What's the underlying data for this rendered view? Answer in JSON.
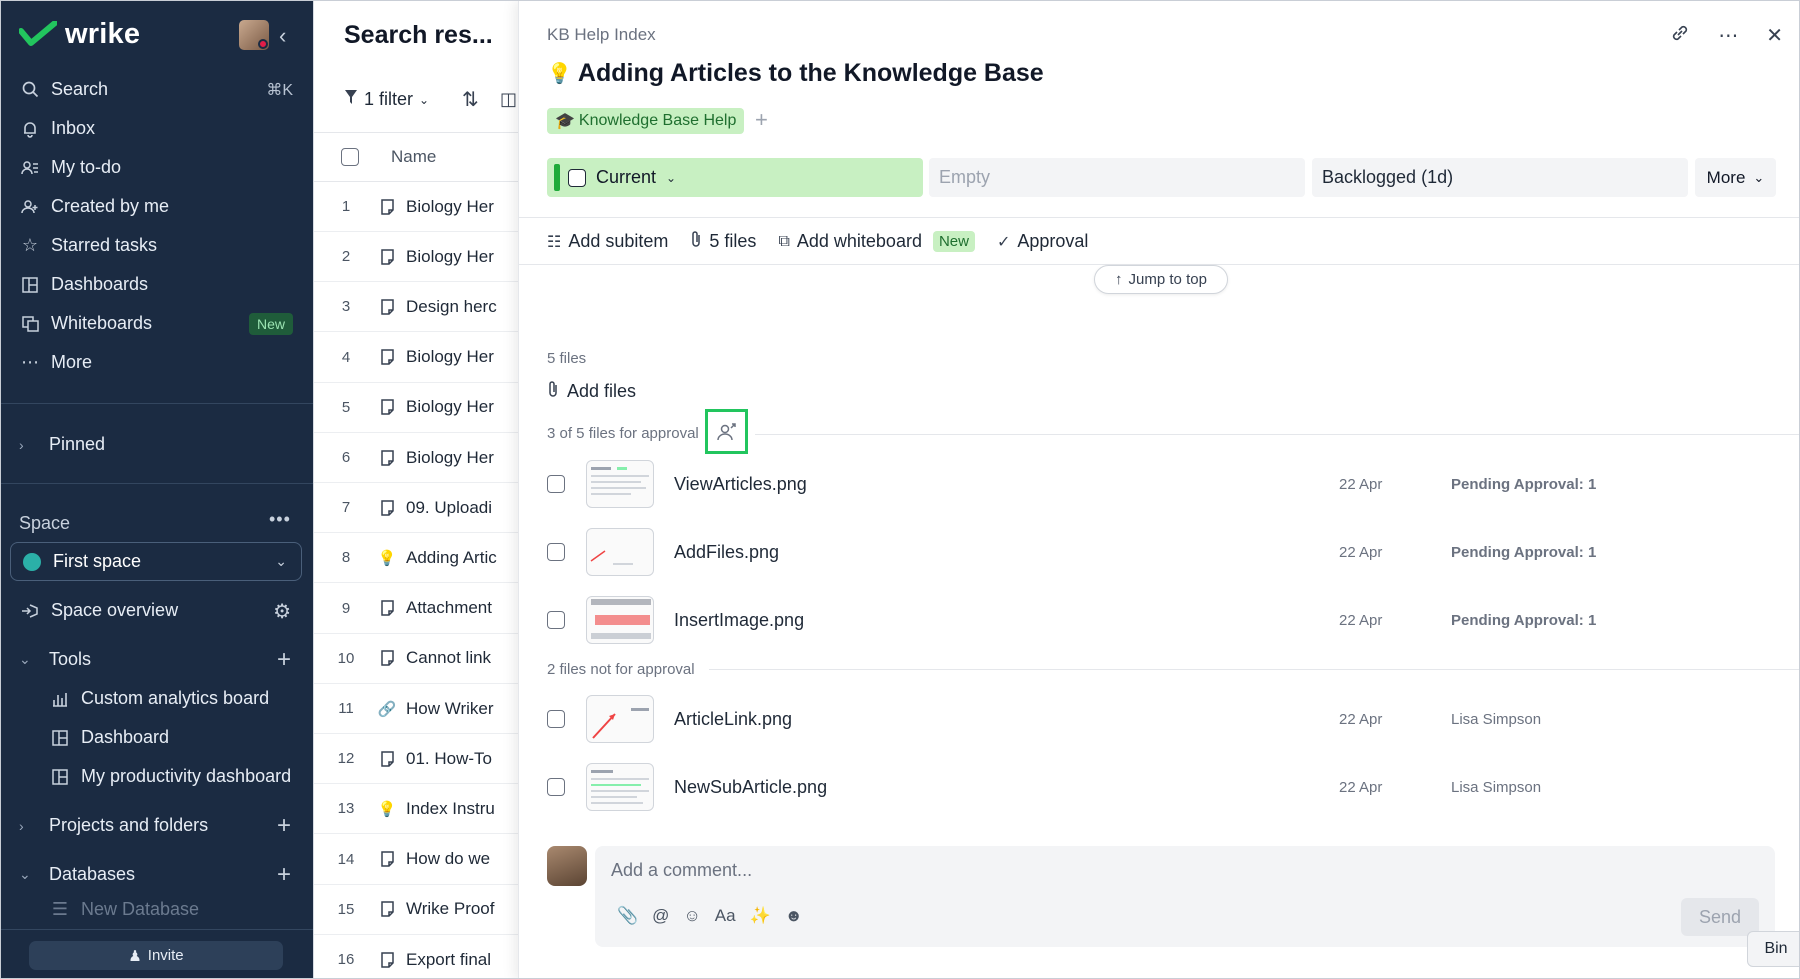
{
  "sidebar": {
    "brand": "wrike",
    "nav": [
      {
        "label": "Search",
        "icon": "search-icon",
        "shortcut": "⌘K"
      },
      {
        "label": "Inbox",
        "icon": "bell-icon"
      },
      {
        "label": "My to-do",
        "icon": "todo-icon"
      },
      {
        "label": "Created by me",
        "icon": "user-plus-icon"
      },
      {
        "label": "Starred tasks",
        "icon": "star-icon"
      },
      {
        "label": "Dashboards",
        "icon": "dashboard-icon"
      },
      {
        "label": "Whiteboards",
        "icon": "whiteboard-icon",
        "badge": "New"
      },
      {
        "label": "More",
        "icon": "more-icon"
      }
    ],
    "pinned": "Pinned",
    "space_label": "Space",
    "space_selected": "First space",
    "space_overview": "Space overview",
    "tools": "Tools",
    "tool_items": [
      "Custom analytics board",
      "Dashboard",
      "My productivity dashboard"
    ],
    "projects": "Projects and folders",
    "databases": "Databases",
    "new_database": "New Database",
    "invite": "Invite"
  },
  "middle": {
    "title": "Search res...",
    "filter": "1 filter",
    "column_name": "Name",
    "rows": [
      {
        "num": "1",
        "title": "Biology Her",
        "icon": "doc"
      },
      {
        "num": "2",
        "title": "Biology Her",
        "icon": "doc"
      },
      {
        "num": "3",
        "title": "Design herc",
        "icon": "doc"
      },
      {
        "num": "4",
        "title": "Biology Her",
        "icon": "doc"
      },
      {
        "num": "5",
        "title": "Biology Her",
        "icon": "doc"
      },
      {
        "num": "6",
        "title": "Biology Her",
        "icon": "doc"
      },
      {
        "num": "7",
        "title": "09. Uploadi",
        "icon": "doc"
      },
      {
        "num": "8",
        "title": "Adding Artic",
        "icon": "bulb"
      },
      {
        "num": "9",
        "title": "Attachment",
        "icon": "doc"
      },
      {
        "num": "10",
        "title": "Cannot link",
        "icon": "doc"
      },
      {
        "num": "11",
        "title": "How Wriker",
        "icon": "link"
      },
      {
        "num": "12",
        "title": "01. How-To",
        "icon": "doc"
      },
      {
        "num": "13",
        "title": "Index Instru",
        "icon": "bulb"
      },
      {
        "num": "14",
        "title": "How do we",
        "icon": "doc"
      },
      {
        "num": "15",
        "title": "Wrike Proof",
        "icon": "doc"
      },
      {
        "num": "16",
        "title": "Export final",
        "icon": "doc"
      }
    ]
  },
  "panel": {
    "breadcrumb": "KB Help Index",
    "title": "Adding Articles to the Knowledge Base",
    "tag": "Knowledge Base Help",
    "status": "Current",
    "field_empty": "Empty",
    "field_backlog": "Backlogged (1d)",
    "more": "More",
    "actions": {
      "add_subitem": "Add subitem",
      "files": "5 files",
      "add_whiteboard": "Add whiteboard",
      "new_badge": "New",
      "approval": "Approval"
    },
    "jump_to_top": "Jump to top",
    "files_count": "5 files",
    "add_files": "Add files",
    "approval_section": "3 of 5 files for approval",
    "non_approval_section": "2 files not for approval",
    "approval_files": [
      {
        "name": "ViewArticles.png",
        "date": "22 Apr",
        "status": "Pending Approval: 1"
      },
      {
        "name": "AddFiles.png",
        "date": "22 Apr",
        "status": "Pending Approval: 1"
      },
      {
        "name": "InsertImage.png",
        "date": "22 Apr",
        "status": "Pending Approval: 1"
      }
    ],
    "other_files": [
      {
        "name": "ArticleLink.png",
        "date": "22 Apr",
        "status": "Lisa Simpson"
      },
      {
        "name": "NewSubArticle.png",
        "date": "22 Apr",
        "status": "Lisa Simpson"
      }
    ],
    "comment_placeholder": "Add a comment...",
    "send": "Send"
  },
  "bin": "Bin",
  "colors": {
    "sidebar_bg": "#1b2b42",
    "status_green": "#c8f0c2",
    "highlight": "#22c55e"
  }
}
